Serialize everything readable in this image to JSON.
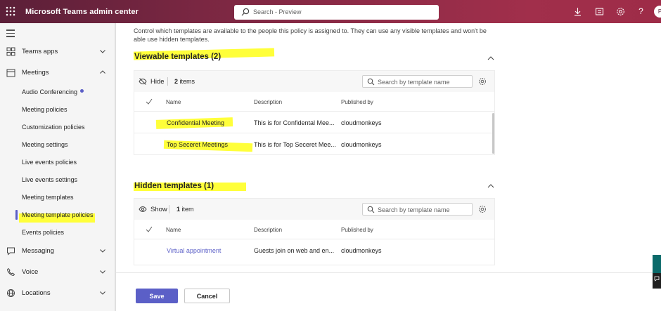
{
  "header": {
    "app_title": "Microsoft Teams admin center",
    "search_placeholder": "Search - Preview",
    "avatar_initial": "P"
  },
  "sidebar": {
    "items": [
      {
        "label": "Teams apps"
      },
      {
        "label": "Meetings"
      },
      {
        "label": "Messaging"
      },
      {
        "label": "Voice"
      },
      {
        "label": "Locations"
      }
    ],
    "meetings_subitems": [
      {
        "label": "Audio Conferencing"
      },
      {
        "label": "Meeting policies"
      },
      {
        "label": "Customization policies"
      },
      {
        "label": "Meeting settings"
      },
      {
        "label": "Live events policies"
      },
      {
        "label": "Live events settings"
      },
      {
        "label": "Meeting templates"
      },
      {
        "label": "Meeting template policies"
      },
      {
        "label": "Events policies"
      }
    ],
    "active_item": "Meeting template policies"
  },
  "main": {
    "intro_text": "Control which templates are available to the people this policy is assigned to. They can use any visible templates and won't be able use hidden templates.",
    "columns": {
      "name": "Name",
      "description": "Description",
      "published_by": "Published by"
    },
    "viewable": {
      "title": "Viewable templates (2)",
      "action_label": "Hide",
      "count_number": "2",
      "count_unit": "items",
      "search_placeholder": "Search by template name",
      "rows": [
        {
          "name": "Confidential Meeting",
          "description": "This is for Confidental Mee...",
          "published_by": "cloudmonkeys"
        },
        {
          "name": "Top Seceret Meetings",
          "description": "This is for Top Seceret Mee...",
          "published_by": "cloudmonkeys"
        }
      ]
    },
    "hidden": {
      "title": "Hidden templates (1)",
      "action_label": "Show",
      "count_number": "1",
      "count_unit": "item",
      "search_placeholder": "Search by template name",
      "rows": [
        {
          "name": "Virtual appointment",
          "description": "Guests join on web and en...",
          "published_by": "cloudmonkeys"
        }
      ]
    }
  },
  "footer": {
    "save_label": "Save",
    "cancel_label": "Cancel"
  },
  "colors": {
    "brand_bar": "#8e2b47",
    "accent": "#5b5fc7",
    "highlight": "#ffff3a"
  }
}
